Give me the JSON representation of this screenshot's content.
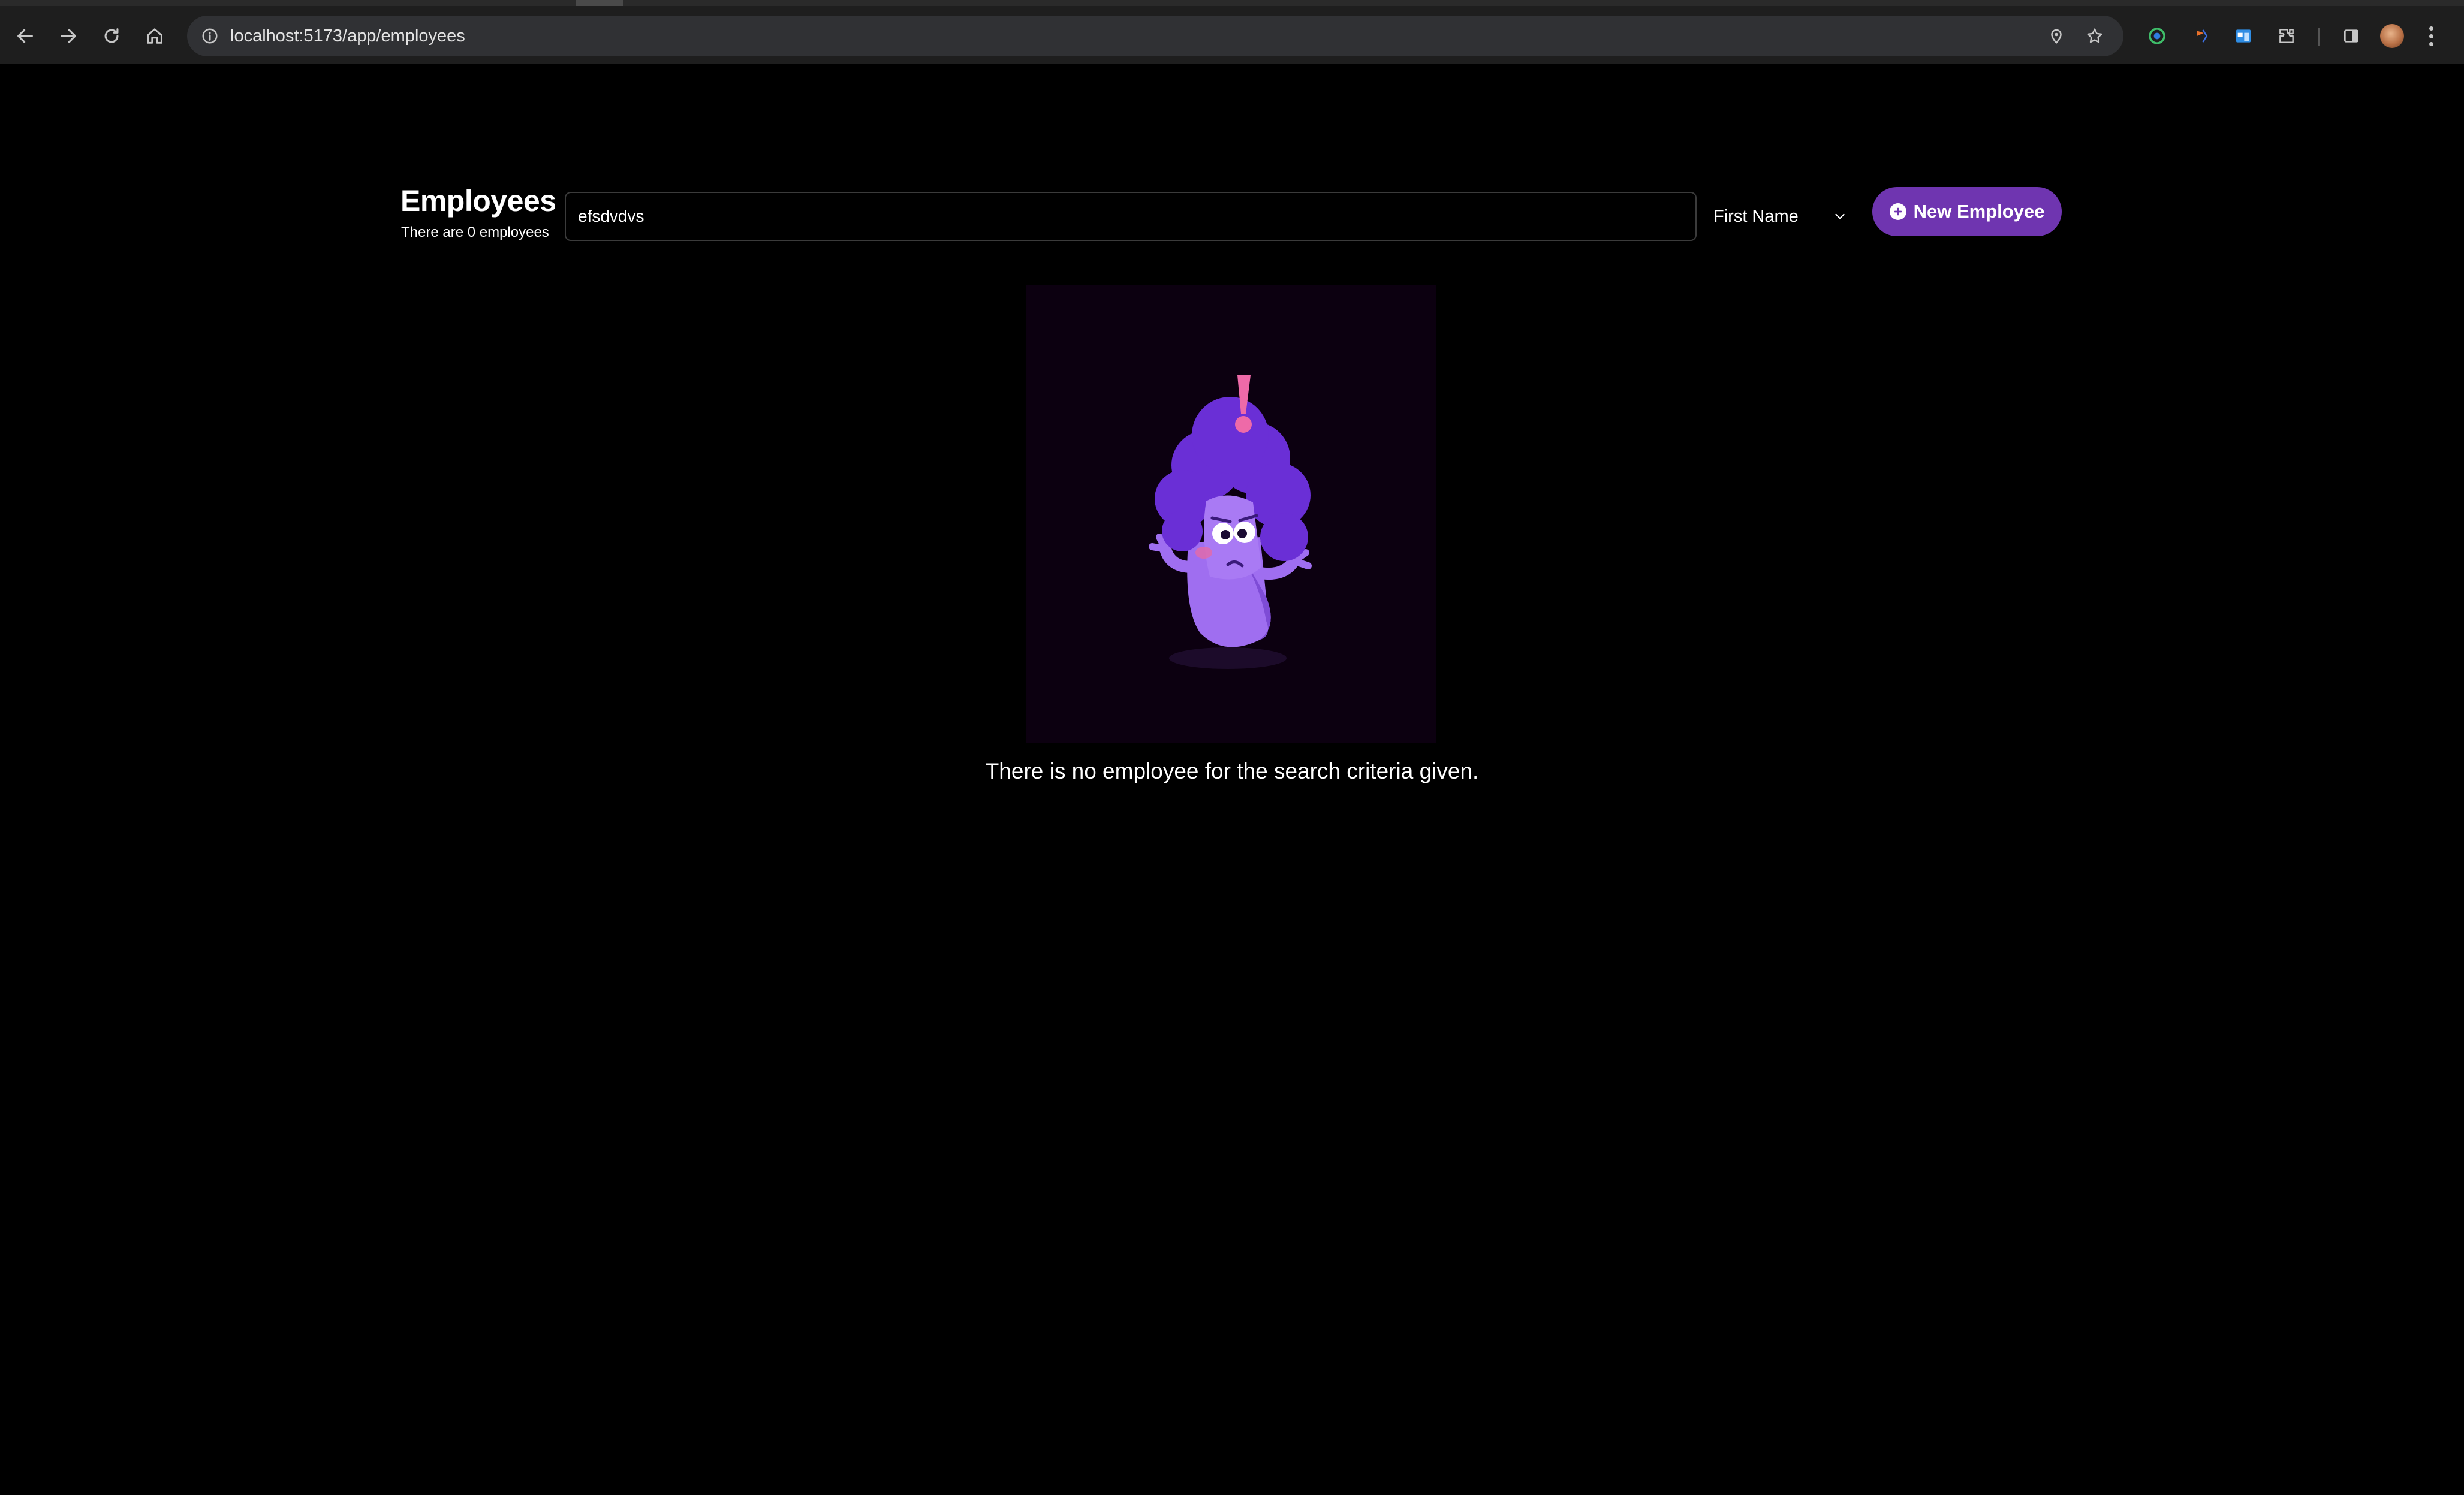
{
  "browser": {
    "url": "localhost:5173/app/employees",
    "icons": [
      "back-icon",
      "forward-icon",
      "reload-icon",
      "home-icon",
      "site-info-icon",
      "location-icon",
      "bookmark-star-icon",
      "extension-icon",
      "side-panel-icon",
      "profile-avatar",
      "menu-icon"
    ]
  },
  "header": {
    "title": "Employees",
    "subtitle": "There are 0 employees"
  },
  "search": {
    "value": "efsdvdvs",
    "filter_field": "First Name"
  },
  "actions": {
    "new_employee_label": "New Employee"
  },
  "empty_state": {
    "message": "There is no employee for the search criteria given."
  },
  "colors": {
    "accent": "#6f35b0",
    "background": "#000000",
    "toolbar": "#1e1e1e"
  }
}
